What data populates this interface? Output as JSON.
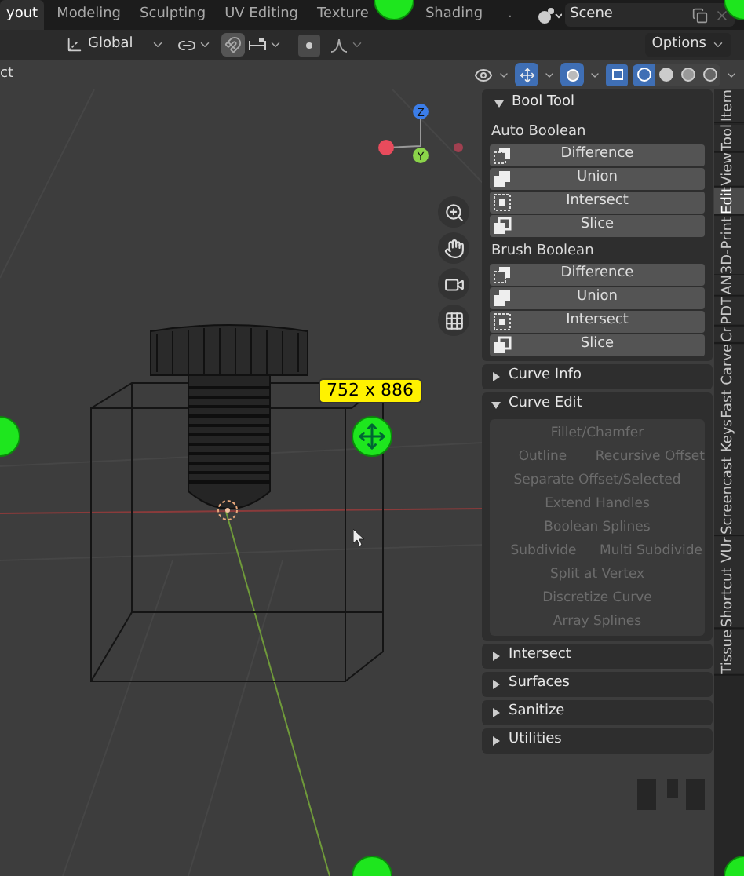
{
  "workspace_tabs": [
    {
      "label": "yout",
      "selected": true
    },
    {
      "label": "Modeling",
      "selected": false
    },
    {
      "label": "Sculpting",
      "selected": false
    },
    {
      "label": "UV Editing",
      "selected": false
    },
    {
      "label": "Texture",
      "selected": false
    },
    {
      "label": "Shading",
      "selected": false
    }
  ],
  "tabs_more": ".",
  "scene": {
    "value": "Scene"
  },
  "toolbar": {
    "orientation": "Global",
    "options": "Options",
    "snap_on": true,
    "proportional_on": true
  },
  "viewport_header": {
    "menu_fragment": "ct",
    "gizmo_on": true,
    "overlays_on": true
  },
  "gizmo": {
    "labels": [
      "Z",
      "Y"
    ]
  },
  "size_label": "752 x 886",
  "panel": {
    "title": "Bool Tool",
    "expanded": true,
    "groups": [
      {
        "title": "Auto Boolean",
        "buttons": [
          {
            "label": "Difference",
            "kind": "difference"
          },
          {
            "label": "Union",
            "kind": "union"
          },
          {
            "label": "Intersect",
            "kind": "intersect"
          },
          {
            "label": "Slice",
            "kind": "slice"
          }
        ]
      },
      {
        "title": "Brush Boolean",
        "buttons": [
          {
            "label": "Difference",
            "kind": "difference"
          },
          {
            "label": "Union",
            "kind": "union"
          },
          {
            "label": "Intersect",
            "kind": "intersect"
          },
          {
            "label": "Slice",
            "kind": "slice"
          }
        ]
      }
    ]
  },
  "subpanels": [
    {
      "title": "Curve Info",
      "expanded": false
    },
    {
      "title": "Curve Edit",
      "expanded": true,
      "disabled": true,
      "rows": [
        [
          "Fillet/Chamfer"
        ],
        [
          "Outline",
          "Recursive Offset"
        ],
        [
          "Separate Offset/Selected"
        ],
        [
          "Extend Handles"
        ],
        [
          "Boolean Splines"
        ],
        [
          "Subdivide",
          "Multi Subdivide"
        ],
        [
          "Split at Vertex"
        ],
        [
          "Discretize Curve"
        ],
        [
          "Array Splines"
        ]
      ]
    },
    {
      "title": "Intersect",
      "expanded": false
    },
    {
      "title": "Surfaces",
      "expanded": false
    },
    {
      "title": "Sanitize",
      "expanded": false
    },
    {
      "title": "Utilities",
      "expanded": false
    }
  ],
  "side_tabs": [
    {
      "label": "Item",
      "selected": false
    },
    {
      "label": "Tool",
      "selected": false
    },
    {
      "label": "View",
      "selected": false
    },
    {
      "label": "Edit",
      "selected": true
    },
    {
      "label": "3D-Print",
      "selected": false
    },
    {
      "label": "AN",
      "selected": false
    },
    {
      "label": "PDT",
      "selected": false
    },
    {
      "label": "Cr",
      "selected": false
    },
    {
      "label": "Fast Carve",
      "selected": false
    },
    {
      "label": "Screencast Keys",
      "selected": false
    },
    {
      "label": "Shortcut VUr",
      "selected": false
    },
    {
      "label": "Tissue",
      "selected": false
    }
  ]
}
